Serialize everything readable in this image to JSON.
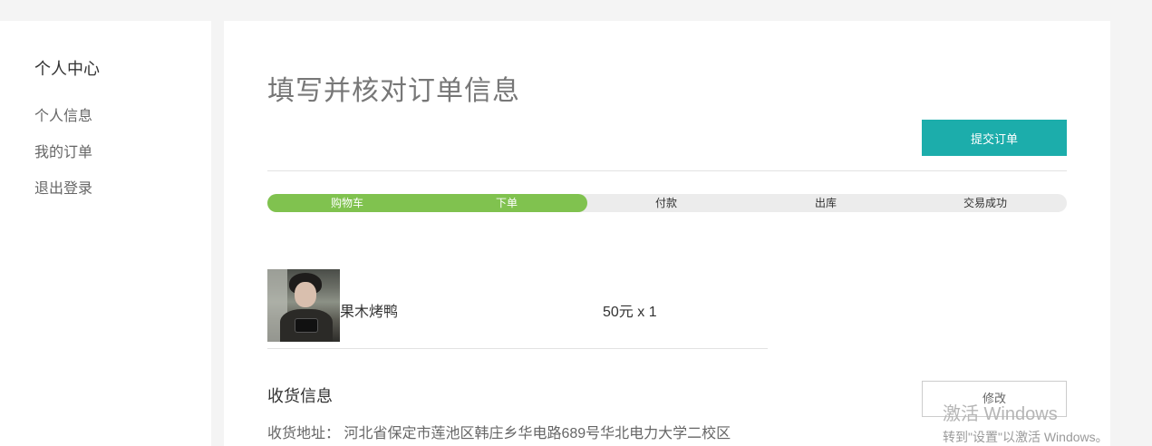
{
  "sidebar": {
    "title": "个人中心",
    "items": [
      {
        "label": "个人信息"
      },
      {
        "label": "我的订单"
      },
      {
        "label": "退出登录"
      }
    ]
  },
  "main": {
    "title": "填写并核对订单信息",
    "submit_label": "提交订单",
    "progress": {
      "steps": [
        {
          "label": "购物车",
          "done": true
        },
        {
          "label": "下单",
          "done": true
        },
        {
          "label": "付款",
          "done": false
        },
        {
          "label": "出库",
          "done": false
        },
        {
          "label": "交易成功",
          "done": false
        }
      ],
      "completed_fraction": 0.4
    },
    "product": {
      "name": "果木烤鸭",
      "price": "50元 x 1"
    },
    "shipping": {
      "title": "收货信息",
      "address": "收货地址：  河北省保定市莲池区韩庄乡华电路689号华北电力大学二校区",
      "edit_label": "修改"
    }
  },
  "watermark": {
    "line1": "激活 Windows",
    "line2": "转到\"设置\"以激活 Windows。"
  }
}
